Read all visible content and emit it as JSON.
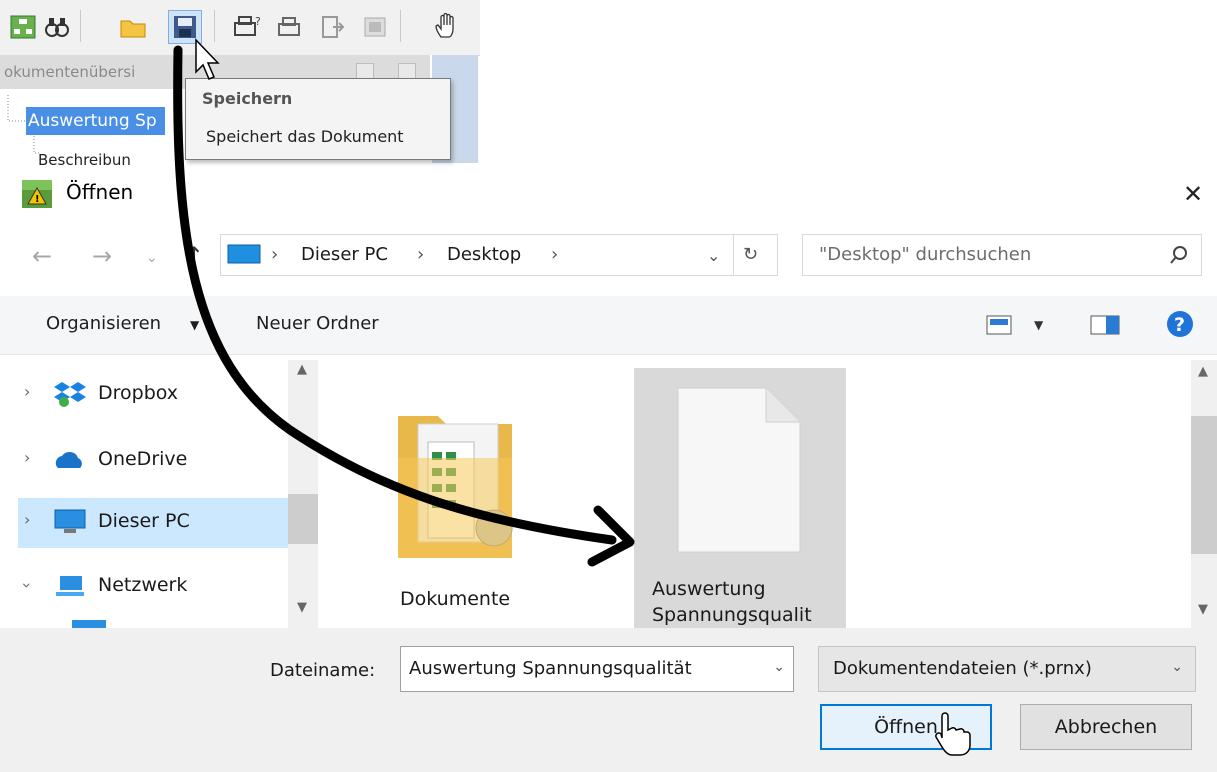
{
  "toolbar": {
    "icons": [
      "tree-icon",
      "binoculars-icon",
      "open-folder-icon",
      "save-icon",
      "print-preview-icon",
      "print-icon",
      "export-icon",
      "window-icon",
      "hand-icon"
    ]
  },
  "doc_panel": {
    "header_text": "okumentenübersi",
    "selected_item": "Auswertung Sp",
    "child_item": "Beschreibun"
  },
  "tooltip": {
    "title": "Speichern",
    "description": "Speichert das Dokument"
  },
  "dialog": {
    "title": "Öffnen",
    "close_glyph": "✕"
  },
  "address": {
    "breadcrumbs": [
      "Dieser PC",
      "Desktop"
    ],
    "separator": "›"
  },
  "search": {
    "placeholder": "\"Desktop\" durchsuchen"
  },
  "command_bar": {
    "organize_label": "Organisieren",
    "new_folder_label": "Neuer Ordner"
  },
  "nav_pane": {
    "items": [
      {
        "label": "Dropbox"
      },
      {
        "label": "OneDrive"
      },
      {
        "label": "Dieser PC"
      },
      {
        "label": "Netzwerk"
      }
    ]
  },
  "files": {
    "folder_name": "Dokumente",
    "doc_name_line1": "Auswertung",
    "doc_name_line2": "Spannungsqualit"
  },
  "bottom": {
    "filename_label": "Dateiname:",
    "filename_value": "Auswertung Spannungsqualität",
    "filetype_value": "Dokumentendateien (*.prnx)",
    "open_label": "Öffnen",
    "cancel_label": "Abbrechen"
  },
  "colors": {
    "accent": "#0078d7",
    "selection": "#cce8ff",
    "tree_selection": "#4a8fe6"
  }
}
